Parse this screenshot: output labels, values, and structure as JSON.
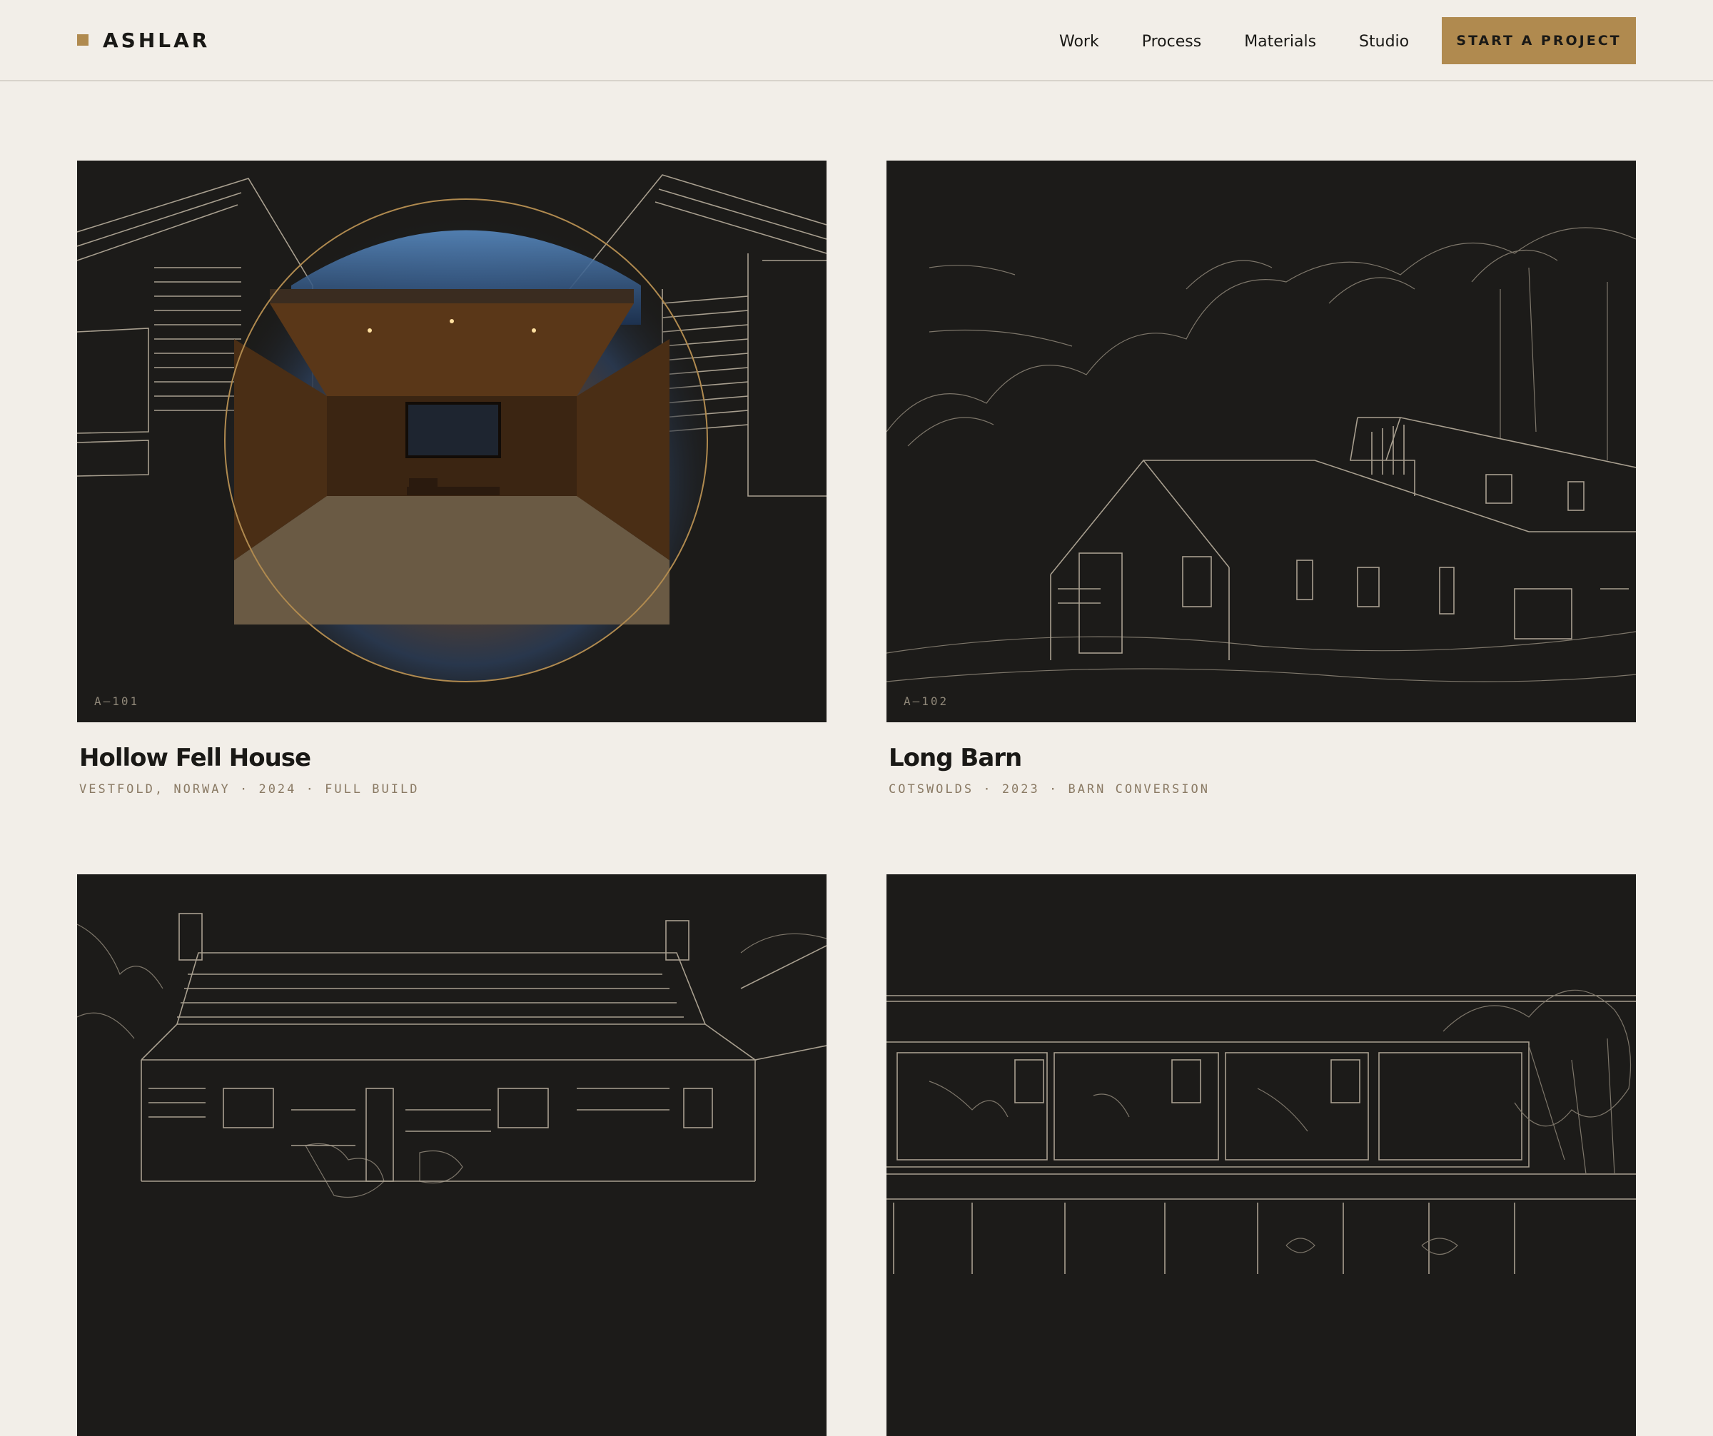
{
  "brand": {
    "name": "ASHLAR",
    "mark_color": "#b08a4f"
  },
  "nav": {
    "items": [
      {
        "label": "Work"
      },
      {
        "label": "Process"
      },
      {
        "label": "Materials"
      },
      {
        "label": "Studio"
      }
    ],
    "cta_label": "START A PROJECT"
  },
  "colors": {
    "background": "#f2eee8",
    "accent": "#b08a4f",
    "card_bg": "#1c1b19"
  },
  "projects": [
    {
      "plate": "A–101",
      "title": "Hollow Fell House",
      "meta": "VESTFOLD, NORWAY · 2024 · FULL BUILD"
    },
    {
      "plate": "A–102",
      "title": "Long Barn",
      "meta": "COTSWOLDS · 2023 · BARN CONVERSION"
    },
    {
      "plate": "",
      "title": "",
      "meta": ""
    },
    {
      "plate": "",
      "title": "",
      "meta": ""
    }
  ]
}
